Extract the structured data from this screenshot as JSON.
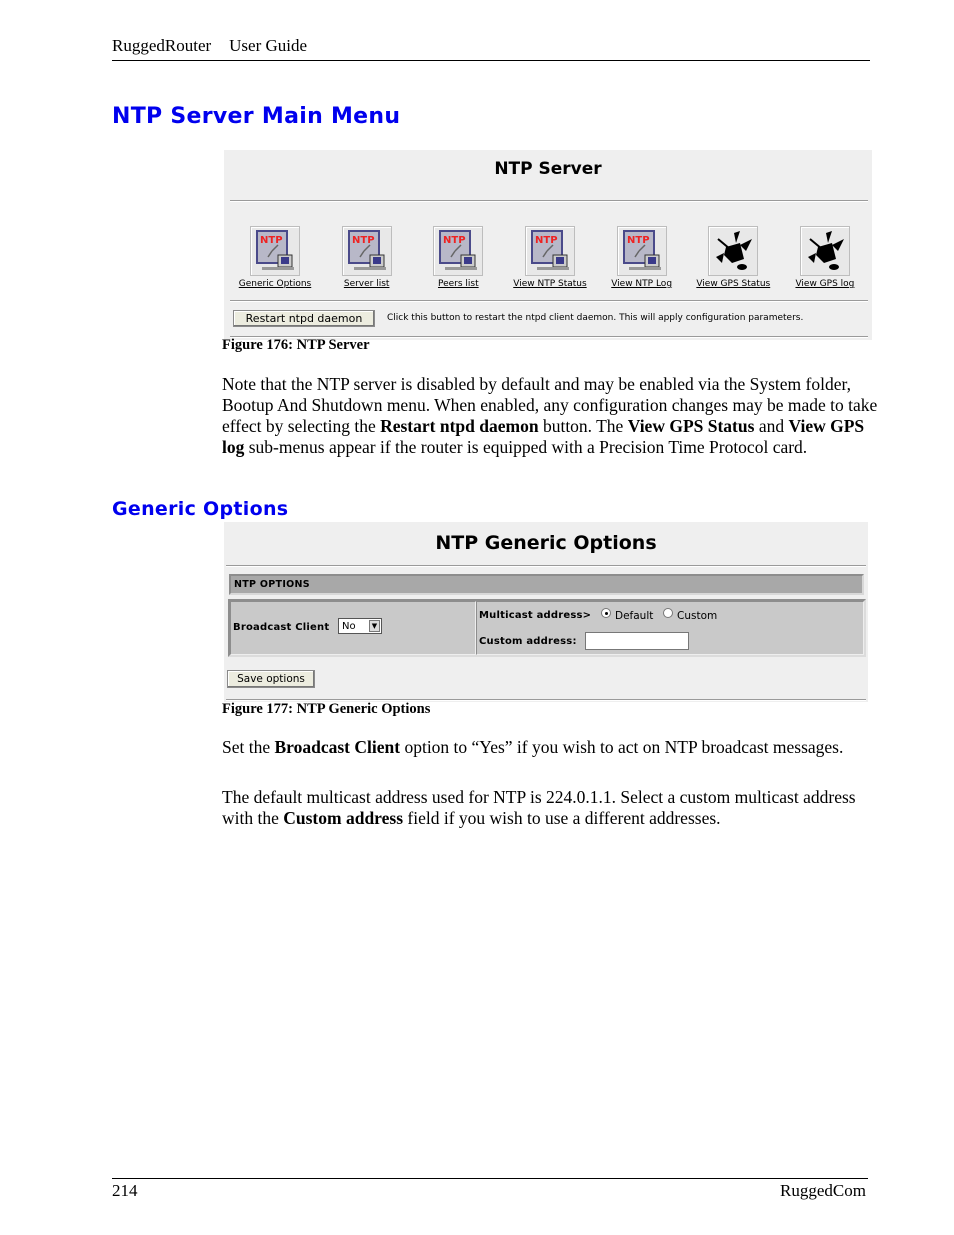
{
  "header": {
    "product": "RuggedRouter",
    "doc": "User Guide"
  },
  "section1": {
    "heading": "NTP Server Main Menu",
    "screenshot": {
      "title": "NTP Server",
      "icons": [
        {
          "label": "Generic Options",
          "icon": "ntp-clock-icon"
        },
        {
          "label": "Server list",
          "icon": "ntp-clock-icon"
        },
        {
          "label": "Peers list",
          "icon": "ntp-clock-icon"
        },
        {
          "label": "View NTP Status",
          "icon": "ntp-clock-icon"
        },
        {
          "label": "View NTP Log",
          "icon": "ntp-clock-icon"
        },
        {
          "label": "View GPS Status",
          "icon": "satellite-icon"
        },
        {
          "label": "View GPS log",
          "icon": "satellite-icon"
        }
      ],
      "ntp_badge": "NTP",
      "restart_button": "Restart ntpd daemon",
      "restart_description": "Click this button to restart the ntpd client daemon. This will apply configuration parameters."
    },
    "caption": "Figure 176: NTP Server",
    "paragraph": {
      "t1": "Note that the NTP server is disabled by default and may be enabled via the System folder, Bootup And Shutdown menu.  When enabled, any configuration changes may be made to take effect by selecting the ",
      "b1": "Restart ntpd daemon",
      "t2": " button.  The ",
      "b2": "View GPS Status",
      "t3": " and ",
      "b3": "View GPS log",
      "t4": " sub-menus appear if the router is equipped with a Precision Time Protocol card."
    }
  },
  "section2": {
    "heading": "Generic Options",
    "screenshot": {
      "title": "NTP Generic Options",
      "section_bar": "NTP OPTIONS",
      "broadcast_label": "Broadcast Client",
      "broadcast_value": "No",
      "multicast_label": "Multicast address>",
      "radio_default": "Default",
      "radio_custom": "Custom",
      "multicast_selected": "Default",
      "custom_address_label": "Custom address:",
      "custom_address_value": "",
      "save_button": "Save options"
    },
    "caption": "Figure 177: NTP Generic Options",
    "paragraph1": {
      "t1": "Set the ",
      "b1": "Broadcast Client",
      "t2": " option to “Yes” if you wish to act on NTP broadcast messages."
    },
    "paragraph2": {
      "t1": "The default multicast address used for NTP is 224.0.1.1.  Select a custom multicast address with the ",
      "b1": "Custom address",
      "t2": " field if you wish to use a different addresses."
    }
  },
  "footer": {
    "page_number": "214",
    "company": "RuggedCom"
  }
}
